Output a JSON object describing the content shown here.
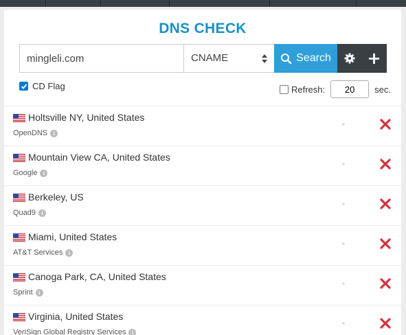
{
  "header": {
    "title": "DNS CHECK"
  },
  "search": {
    "domain_value": "mingleli.com",
    "record_type": "CNAME",
    "search_label": "Search",
    "cd_flag_label": "CD Flag",
    "cd_flag_checked": true,
    "refresh_label": "Refresh:",
    "refresh_checked": false,
    "refresh_value": "20",
    "refresh_unit": "sec."
  },
  "colors": {
    "accent": "#1b8fc4",
    "button": "#2f9fd9",
    "dark": "#3a3f44",
    "remove": "#d9303a"
  },
  "results": [
    {
      "flag": "us-flag-icon",
      "location": "Holtsville NY, United States",
      "provider": "OpenDNS",
      "result": "-"
    },
    {
      "flag": "us-flag-icon",
      "location": "Mountain View CA, United States",
      "provider": "Google",
      "result": "-"
    },
    {
      "flag": "us-flag-icon",
      "location": "Berkeley, US",
      "provider": "Quad9",
      "result": "-"
    },
    {
      "flag": "us-flag-icon",
      "location": "Miami, United States",
      "provider": "AT&T Services",
      "result": "-"
    },
    {
      "flag": "us-flag-icon",
      "location": "Canoga Park, CA, United States",
      "provider": "Sprint",
      "result": "-"
    },
    {
      "flag": "us-flag-icon",
      "location": "Virginia, United States",
      "provider": "VeriSign Global Registry Services",
      "result": "-"
    }
  ]
}
